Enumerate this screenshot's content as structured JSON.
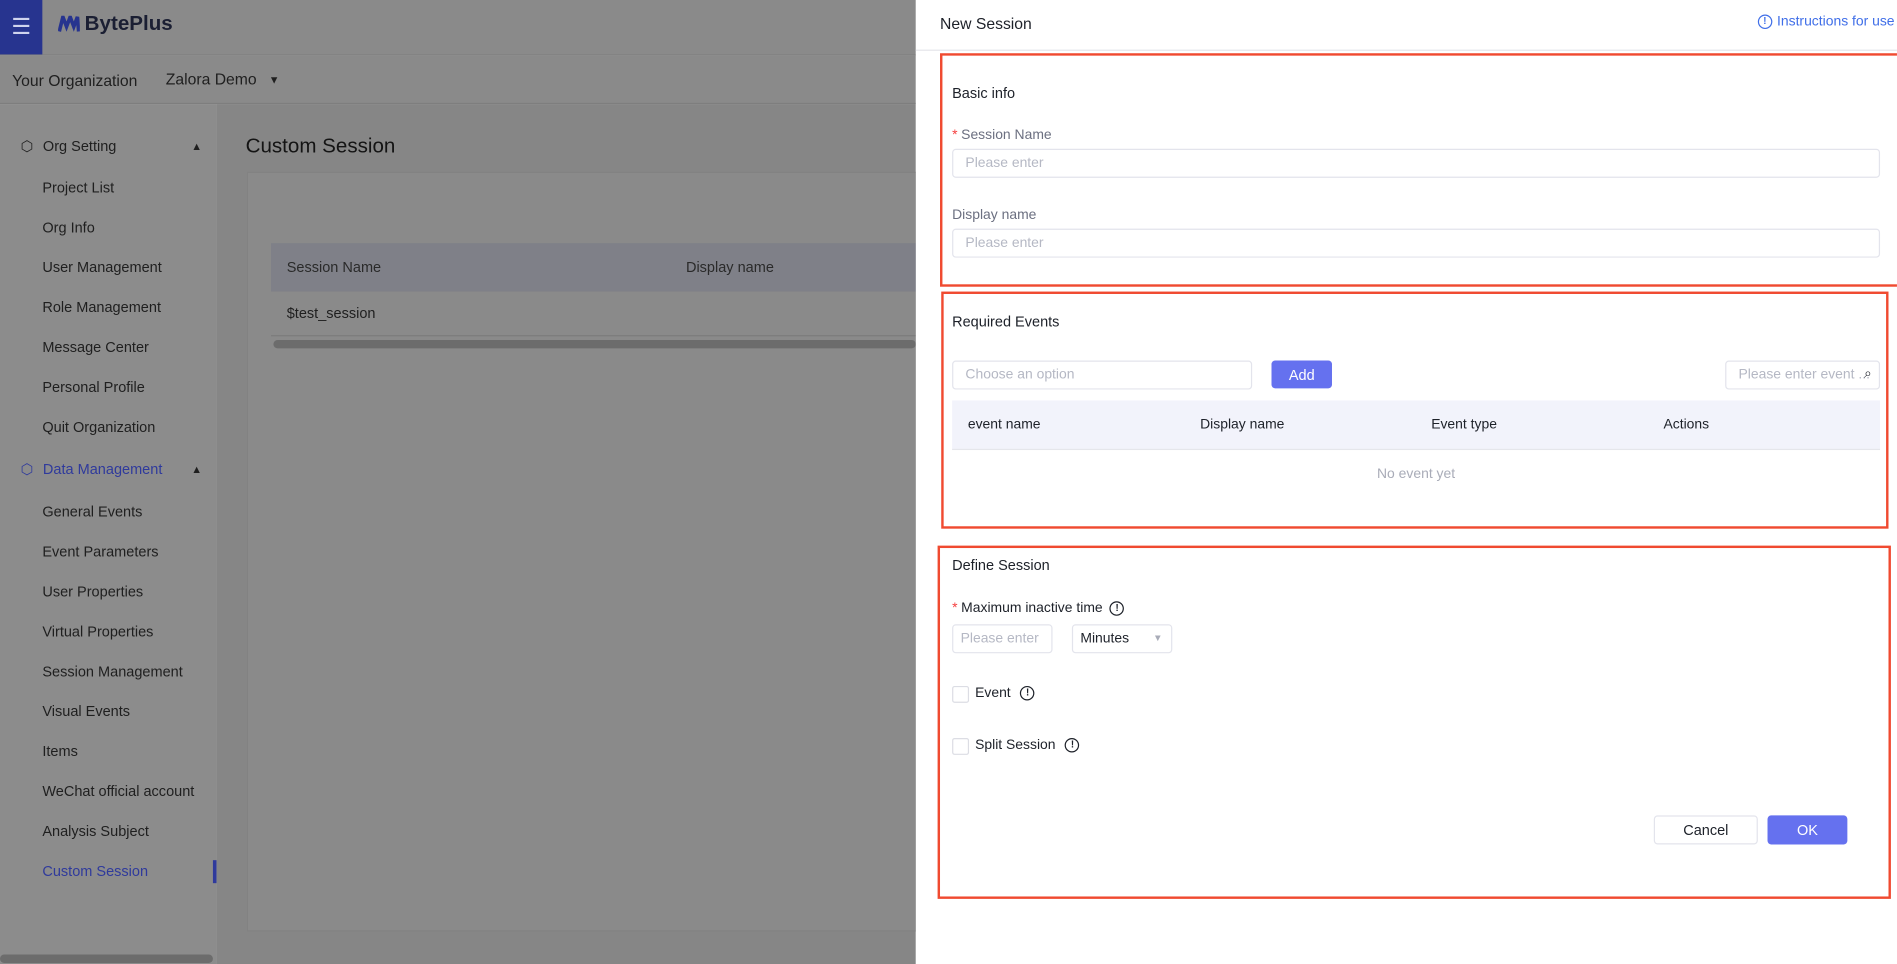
{
  "app": {
    "brand": "BytePlus",
    "menu_icon": "hamburger-icon"
  },
  "org_bar": {
    "label": "Your Organization",
    "selected_org": "Zalora Demo"
  },
  "sidebar": {
    "groups": [
      {
        "label": "Org Setting",
        "icon": "cube-icon",
        "items": [
          "Project List",
          "Org Info",
          "User Management",
          "Role Management",
          "Message Center",
          "Personal Profile",
          "Quit Organization"
        ]
      },
      {
        "label": "Data Management",
        "icon": "cube-icon",
        "items": [
          "General Events",
          "Event Parameters",
          "User Properties",
          "Virtual Properties",
          "Session Management",
          "Visual Events",
          "Items",
          "WeChat official account",
          "Analysis Subject",
          "Custom Session"
        ]
      }
    ],
    "active_item": "Custom Session"
  },
  "main": {
    "title": "Custom Session",
    "table": {
      "columns": [
        "Session Name",
        "Display name"
      ],
      "rows": [
        [
          "$test_session",
          ""
        ]
      ]
    }
  },
  "drawer": {
    "title": "New Session",
    "instructions_link": "Instructions for use",
    "basic_info": {
      "title": "Basic info",
      "session_name_label": "Session Name",
      "session_name_placeholder": "Please enter",
      "display_name_label": "Display name",
      "display_name_placeholder": "Please enter"
    },
    "required_events": {
      "title": "Required Events",
      "select_placeholder": "Choose an option",
      "add_label": "Add",
      "search_placeholder": "Please enter event ...",
      "columns": [
        "event name",
        "Display name",
        "Event type",
        "Actions"
      ],
      "empty_text": "No event yet"
    },
    "define_session": {
      "title": "Define Session",
      "max_inactive_label": "Maximum inactive time",
      "max_inactive_placeholder": "Please enter",
      "unit": "Minutes",
      "event_label": "Event",
      "split_label": "Split Session"
    },
    "cancel_label": "Cancel",
    "ok_label": "OK"
  },
  "colors": {
    "primary": "#6571ef",
    "link": "#3f6ee8",
    "highlight_box": "#f04a30",
    "required": "#f53f3f"
  }
}
